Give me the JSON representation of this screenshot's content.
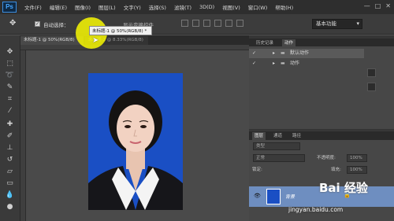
{
  "app": {
    "logo": "Ps"
  },
  "menu": [
    "文件(F)",
    "编辑(E)",
    "图像(I)",
    "图层(L)",
    "文字(Y)",
    "选择(S)",
    "滤镜(T)",
    "3D(D)",
    "视图(V)",
    "窗口(W)",
    "帮助(H)"
  ],
  "window_controls": [
    "—",
    "□",
    "✕"
  ],
  "options": {
    "auto_select_label": "自动选择：",
    "transform_label": "显示变换控件",
    "workspace": "基本功能"
  },
  "tooltip": "未标题-1 @ 50%(RGB/8) *",
  "tabs": [
    "未标题-1 @ 50%(RGB/8)",
    "未标题-2 @ 8.33%(RGB/8)"
  ],
  "panels": {
    "history_tabs": [
      "历史记录",
      "动作"
    ],
    "actions": [
      {
        "label": "默认动作",
        "checked": true,
        "selected": true
      },
      {
        "label": "动作",
        "checked": true,
        "selected": false
      }
    ],
    "layers_tabs": [
      "图层",
      "通道",
      "路径"
    ],
    "kind_label": "类型",
    "blend_mode": "正常",
    "opacity_label": "不透明度:",
    "opacity_value": "100%",
    "lock_label": "锁定:",
    "fill_label": "填充:",
    "fill_value": "100%",
    "layer_name": "背景"
  },
  "watermark": {
    "text": "Bai 经验",
    "url": "jingyan.baidu.com"
  },
  "colors": {
    "photo_background": "#1a4fc4",
    "selected_layer": "#6e8ec0",
    "highlight": "#ffff00"
  }
}
